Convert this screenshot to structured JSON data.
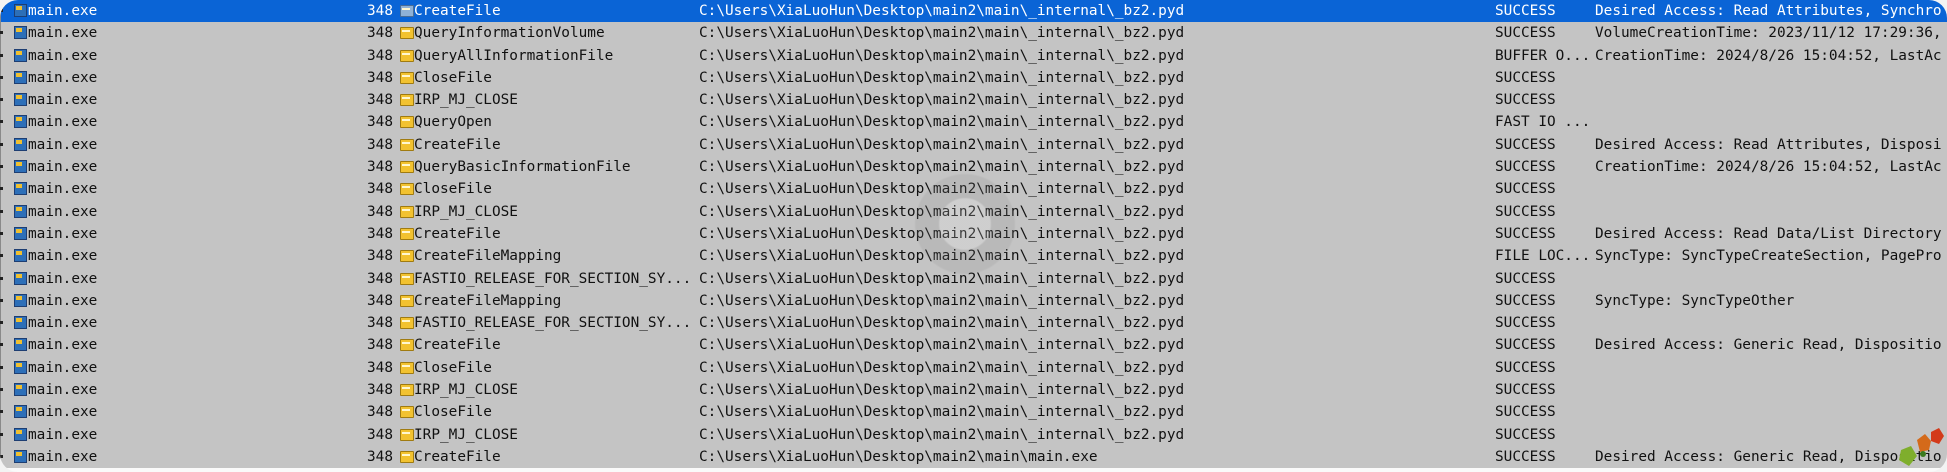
{
  "rows": [
    {
      "process": "main.exe",
      "pid": "348",
      "operation": "CreateFile",
      "path": "C:\\Users\\XiaLuoHun\\Desktop\\main2\\main\\_internal\\_bz2.pyd",
      "result": "SUCCESS",
      "detail": "Desired Access: Read Attributes, Synchro"
    },
    {
      "process": "main.exe",
      "pid": "348",
      "operation": "QueryInformationVolume",
      "path": "C:\\Users\\XiaLuoHun\\Desktop\\main2\\main\\_internal\\_bz2.pyd",
      "result": "SUCCESS",
      "detail": "VolumeCreationTime: 2023/11/12 17:29:36,"
    },
    {
      "process": "main.exe",
      "pid": "348",
      "operation": "QueryAllInformationFile",
      "path": "C:\\Users\\XiaLuoHun\\Desktop\\main2\\main\\_internal\\_bz2.pyd",
      "result": "BUFFER O...",
      "detail": "CreationTime: 2024/8/26 15:04:52, LastAc"
    },
    {
      "process": "main.exe",
      "pid": "348",
      "operation": "CloseFile",
      "path": "C:\\Users\\XiaLuoHun\\Desktop\\main2\\main\\_internal\\_bz2.pyd",
      "result": "SUCCESS",
      "detail": ""
    },
    {
      "process": "main.exe",
      "pid": "348",
      "operation": "IRP_MJ_CLOSE",
      "path": "C:\\Users\\XiaLuoHun\\Desktop\\main2\\main\\_internal\\_bz2.pyd",
      "result": "SUCCESS",
      "detail": ""
    },
    {
      "process": "main.exe",
      "pid": "348",
      "operation": "QueryOpen",
      "path": "C:\\Users\\XiaLuoHun\\Desktop\\main2\\main\\_internal\\_bz2.pyd",
      "result": "FAST IO ...",
      "detail": ""
    },
    {
      "process": "main.exe",
      "pid": "348",
      "operation": "CreateFile",
      "path": "C:\\Users\\XiaLuoHun\\Desktop\\main2\\main\\_internal\\_bz2.pyd",
      "result": "SUCCESS",
      "detail": "Desired Access: Read Attributes, Disposi"
    },
    {
      "process": "main.exe",
      "pid": "348",
      "operation": "QueryBasicInformationFile",
      "path": "C:\\Users\\XiaLuoHun\\Desktop\\main2\\main\\_internal\\_bz2.pyd",
      "result": "SUCCESS",
      "detail": "CreationTime: 2024/8/26 15:04:52, LastAc"
    },
    {
      "process": "main.exe",
      "pid": "348",
      "operation": "CloseFile",
      "path": "C:\\Users\\XiaLuoHun\\Desktop\\main2\\main\\_internal\\_bz2.pyd",
      "result": "SUCCESS",
      "detail": ""
    },
    {
      "process": "main.exe",
      "pid": "348",
      "operation": "IRP_MJ_CLOSE",
      "path": "C:\\Users\\XiaLuoHun\\Desktop\\main2\\main\\_internal\\_bz2.pyd",
      "result": "SUCCESS",
      "detail": ""
    },
    {
      "process": "main.exe",
      "pid": "348",
      "operation": "CreateFile",
      "path": "C:\\Users\\XiaLuoHun\\Desktop\\main2\\main\\_internal\\_bz2.pyd",
      "result": "SUCCESS",
      "detail": "Desired Access: Read Data/List Directory"
    },
    {
      "process": "main.exe",
      "pid": "348",
      "operation": "CreateFileMapping",
      "path": "C:\\Users\\XiaLuoHun\\Desktop\\main2\\main\\_internal\\_bz2.pyd",
      "result": "FILE LOC...",
      "detail": "SyncType: SyncTypeCreateSection, PagePro"
    },
    {
      "process": "main.exe",
      "pid": "348",
      "operation": "FASTIO_RELEASE_FOR_SECTION_SY...",
      "path": "C:\\Users\\XiaLuoHun\\Desktop\\main2\\main\\_internal\\_bz2.pyd",
      "result": "SUCCESS",
      "detail": ""
    },
    {
      "process": "main.exe",
      "pid": "348",
      "operation": "CreateFileMapping",
      "path": "C:\\Users\\XiaLuoHun\\Desktop\\main2\\main\\_internal\\_bz2.pyd",
      "result": "SUCCESS",
      "detail": "SyncType: SyncTypeOther"
    },
    {
      "process": "main.exe",
      "pid": "348",
      "operation": "FASTIO_RELEASE_FOR_SECTION_SY...",
      "path": "C:\\Users\\XiaLuoHun\\Desktop\\main2\\main\\_internal\\_bz2.pyd",
      "result": "SUCCESS",
      "detail": ""
    },
    {
      "process": "main.exe",
      "pid": "348",
      "operation": "CreateFile",
      "path": "C:\\Users\\XiaLuoHun\\Desktop\\main2\\main\\_internal\\_bz2.pyd",
      "result": "SUCCESS",
      "detail": "Desired Access: Generic Read, Dispositio"
    },
    {
      "process": "main.exe",
      "pid": "348",
      "operation": "CloseFile",
      "path": "C:\\Users\\XiaLuoHun\\Desktop\\main2\\main\\_internal\\_bz2.pyd",
      "result": "SUCCESS",
      "detail": ""
    },
    {
      "process": "main.exe",
      "pid": "348",
      "operation": "IRP_MJ_CLOSE",
      "path": "C:\\Users\\XiaLuoHun\\Desktop\\main2\\main\\_internal\\_bz2.pyd",
      "result": "SUCCESS",
      "detail": ""
    },
    {
      "process": "main.exe",
      "pid": "348",
      "operation": "CloseFile",
      "path": "C:\\Users\\XiaLuoHun\\Desktop\\main2\\main\\_internal\\_bz2.pyd",
      "result": "SUCCESS",
      "detail": ""
    },
    {
      "process": "main.exe",
      "pid": "348",
      "operation": "IRP_MJ_CLOSE",
      "path": "C:\\Users\\XiaLuoHun\\Desktop\\main2\\main\\_internal\\_bz2.pyd",
      "result": "SUCCESS",
      "detail": ""
    },
    {
      "process": "main.exe",
      "pid": "348",
      "operation": "CreateFile",
      "path": "C:\\Users\\XiaLuoHun\\Desktop\\main2\\main\\main.exe",
      "result": "SUCCESS",
      "detail": "Desired Access: Generic Read, Dispositio"
    }
  ],
  "icons": {
    "process": "process-exe-icon",
    "operation": "filesystem-operation-icon"
  },
  "colors": {
    "row_bg": "#c4c4c4",
    "selected_bg": "#0a64d6",
    "selected_fg": "#ffffff"
  }
}
